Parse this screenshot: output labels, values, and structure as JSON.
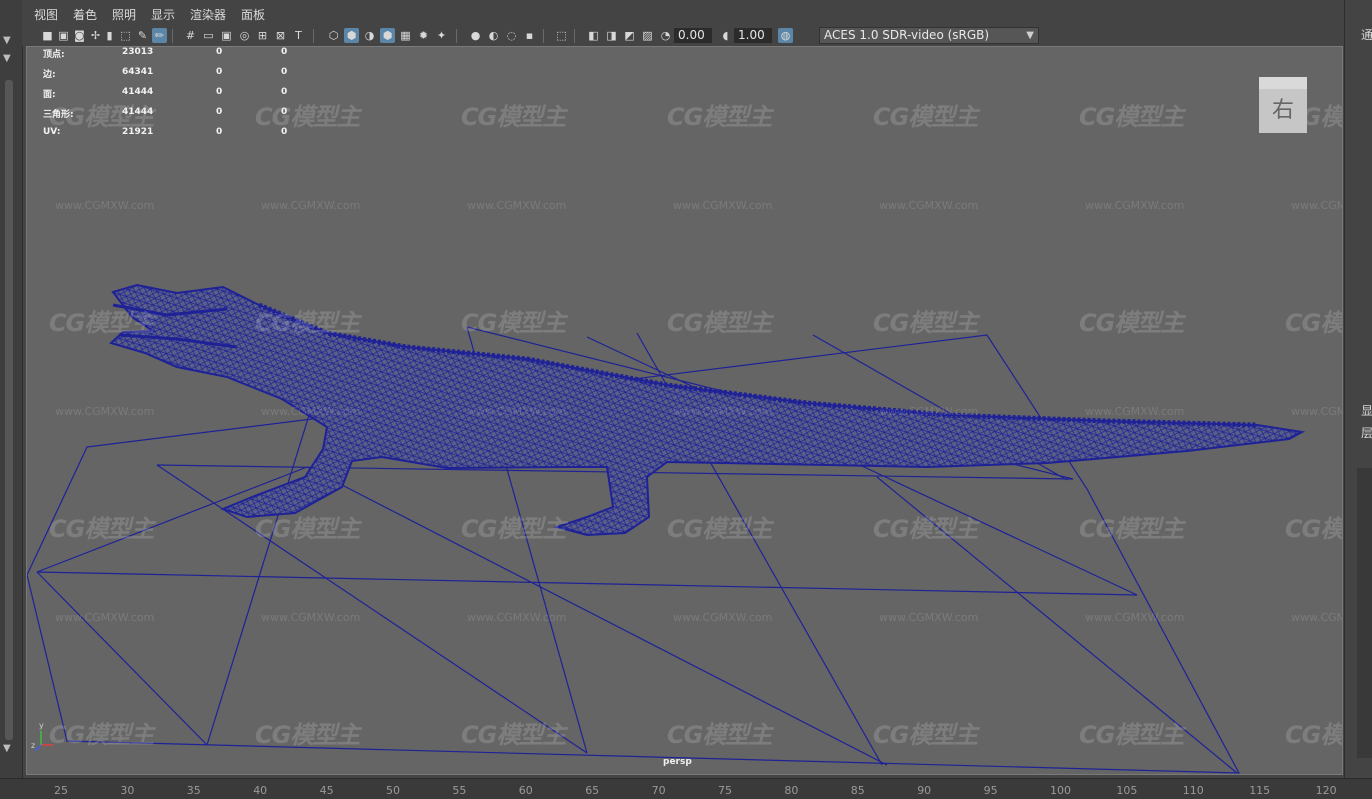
{
  "menu": [
    "视图",
    "着色",
    "照明",
    "显示",
    "渲染器",
    "面板"
  ],
  "toolbar": {
    "exposure_value": "0.00",
    "gamma_value": "1.00",
    "color_space": "ACES 1.0 SDR-video (sRGB)"
  },
  "hud": {
    "rows": [
      {
        "label": "顶点:",
        "value": "23013",
        "c1": "0",
        "c2": "0"
      },
      {
        "label": "边:",
        "value": "64341",
        "c1": "0",
        "c2": "0"
      },
      {
        "label": "面:",
        "value": "41444",
        "c1": "0",
        "c2": "0"
      },
      {
        "label": "三角形:",
        "value": "41444",
        "c1": "0",
        "c2": "0"
      },
      {
        "label": "UV:",
        "value": "21921",
        "c1": "0",
        "c2": "0"
      }
    ]
  },
  "camera_label": "persp",
  "viewcube_face": "右",
  "axis_labels": {
    "y": "y",
    "z": "z"
  },
  "watermark": {
    "logo": "CG模型主",
    "url": "www.CGMXW.com"
  },
  "right_panel": {
    "top": "通",
    "mid1": "显",
    "mid2": "层"
  },
  "ruler": [
    "25",
    "30",
    "35",
    "40",
    "45",
    "50",
    "55",
    "60",
    "65",
    "70",
    "75",
    "80",
    "85",
    "90",
    "95",
    "100",
    "105",
    "110",
    "115",
    "120"
  ],
  "colors": {
    "wireframe": "#1e2296",
    "viewport_bg": "#656565",
    "highlight": "#5b86a8"
  }
}
